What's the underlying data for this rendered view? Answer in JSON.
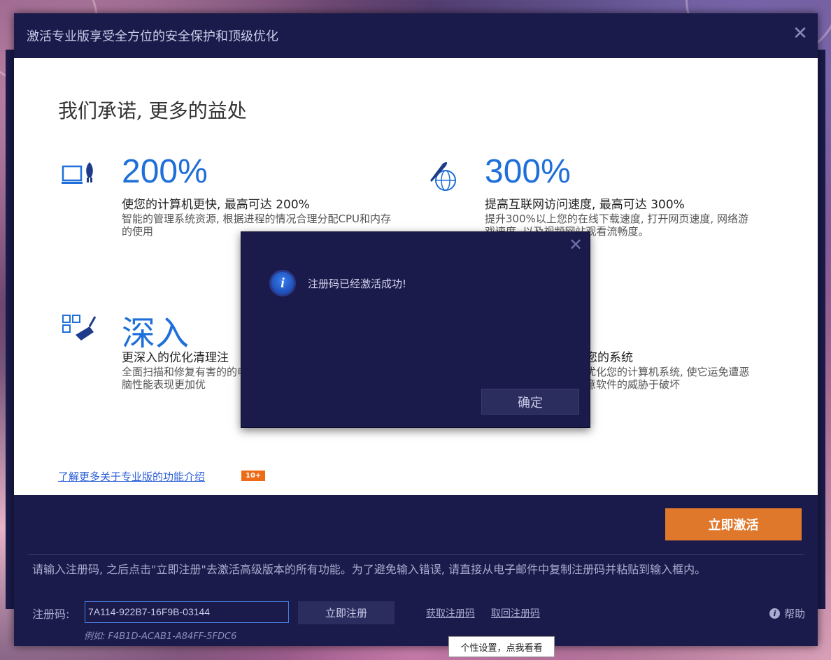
{
  "window": {
    "title": "激活专业版享受全方位的安全保护和顶级优化",
    "close_label": "✕"
  },
  "headline": "我们承诺, 更多的益处",
  "features": [
    {
      "icon": "computer-rocket-icon",
      "big": "200%",
      "sub": "使您的计算机更快, 最高可达 200%",
      "desc": "智能的管理系统资源, 根据进程的情况合理分配CPU和内存的使用"
    },
    {
      "icon": "rocket-globe-icon",
      "big": "300%",
      "sub": "提高互联网访问速度, 最高可达 300%",
      "desc": "提升300%以上您的在线下载速度, 打开网页速度, 网络游戏速度, 以及视频网站观看流畅度。"
    },
    {
      "icon": "broom-clean-icon",
      "big": "深入",
      "sub": "更深入的优化清理注",
      "desc": "全面扫描和修复有害的的电脑性能表现更加优"
    },
    {
      "icon": "shield-icon",
      "big": "",
      "sub": "您的系统",
      "desc": "优化您的计算机系统, 使它运免遭恶意软件的威胁于破坏"
    }
  ],
  "learn_more": "了解更多关于专业版的功能介绍",
  "badge": "10+",
  "activate_button": "立即激活",
  "instructions": "请输入注册码, 之后点击\"立即注册\"去激活高级版本的所有功能。为了避免输入错误, 请直接从电子邮件中复制注册码并粘贴到输入框内。",
  "registration": {
    "label": "注册码:",
    "value": "7A114-922B7-16F9B-03144",
    "example": "例如: F4B1D-ACAB1-A84FF-5FDC6",
    "register_button": "立即注册",
    "get_link": "获取注册码",
    "retrieve_link": "取回注册码",
    "help": "帮助"
  },
  "modal": {
    "message": "注册码已经激活成功!",
    "ok_button": "确定",
    "close_label": "✕"
  },
  "tooltip": "个性设置，点我看看",
  "colors": {
    "accent": "#e0782c",
    "title_blue": "#1e6fd9",
    "dark_bg": "#1a1b4a"
  }
}
